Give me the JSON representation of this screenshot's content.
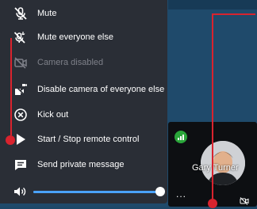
{
  "menu": {
    "items": [
      {
        "label": "Mute",
        "icon": "mic-off-icon",
        "enabled": true
      },
      {
        "label": "Mute everyone else",
        "icon": "mic-all-off-icon",
        "enabled": true
      },
      {
        "label": "Camera disabled",
        "icon": "camera-off-icon",
        "enabled": false
      },
      {
        "label": "Disable camera of everyone else",
        "icon": "camera-all-off-icon",
        "enabled": true
      },
      {
        "label": "Kick out",
        "icon": "close-circle-icon",
        "enabled": true
      },
      {
        "label": "Start / Stop remote control",
        "icon": "play-icon",
        "enabled": true
      },
      {
        "label": "Send private message",
        "icon": "message-icon",
        "enabled": true
      }
    ],
    "volume": {
      "icon": "volume-icon",
      "level_percent": 100
    }
  },
  "participant": {
    "name": "Gary Turner",
    "connection_icon": "signal-icon",
    "more_label": "...",
    "status_icon": "camera-off-icon"
  },
  "colors": {
    "accent": "#4aa3ff",
    "annotation": "#d9232e",
    "menu_bg": "#2a2e36",
    "background": "#1f4a6b",
    "signal": "#2aa63a"
  }
}
